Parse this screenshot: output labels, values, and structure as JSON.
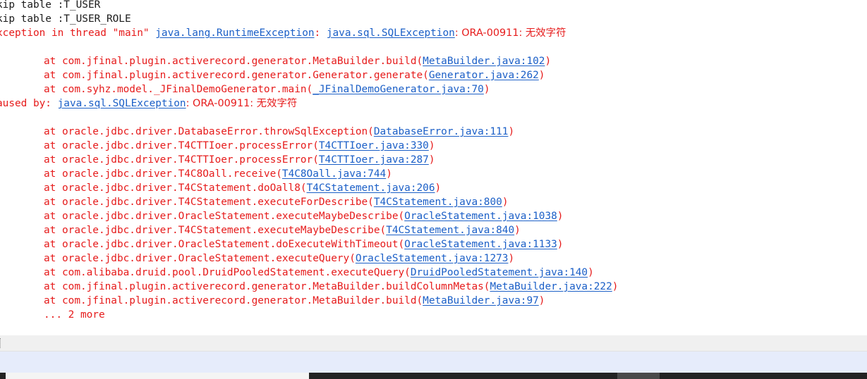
{
  "console": {
    "skip1": "kip table :T_USER",
    "skip2": "kip table :T_USER_ROLE",
    "exception": {
      "prefix": "xception in thread \"main\" ",
      "link1": "java.lang.RuntimeException",
      "sep": ": ",
      "link2": "java.sql.SQLException",
      "msg": ": ORA-00911: 无效字符"
    },
    "trace1": [
      {
        "at": "at com.jfinal.plugin.activerecord.generator.MetaBuilder.build(",
        "link": "MetaBuilder.java:102",
        "end": ")"
      },
      {
        "at": "at com.jfinal.plugin.activerecord.generator.Generator.generate(",
        "link": "Generator.java:262",
        "end": ")"
      },
      {
        "at": "at com.syhz.model._JFinalDemoGenerator.main(",
        "link": "_JFinalDemoGenerator.java:70",
        "end": ")"
      }
    ],
    "caused": {
      "prefix": "aused by: ",
      "link": "java.sql.SQLException",
      "msg": ": ORA-00911: 无效字符"
    },
    "trace2": [
      {
        "at": "at oracle.jdbc.driver.DatabaseError.throwSqlException(",
        "link": "DatabaseError.java:111",
        "end": ")"
      },
      {
        "at": "at oracle.jdbc.driver.T4CTTIoer.processError(",
        "link": "T4CTTIoer.java:330",
        "end": ")"
      },
      {
        "at": "at oracle.jdbc.driver.T4CTTIoer.processError(",
        "link": "T4CTTIoer.java:287",
        "end": ")"
      },
      {
        "at": "at oracle.jdbc.driver.T4C8Oall.receive(",
        "link": "T4C8Oall.java:744",
        "end": ")"
      },
      {
        "at": "at oracle.jdbc.driver.T4CStatement.doOall8(",
        "link": "T4CStatement.java:206",
        "end": ")"
      },
      {
        "at": "at oracle.jdbc.driver.T4CStatement.executeForDescribe(",
        "link": "T4CStatement.java:800",
        "end": ")"
      },
      {
        "at": "at oracle.jdbc.driver.OracleStatement.executeMaybeDescribe(",
        "link": "OracleStatement.java:1038",
        "end": ")"
      },
      {
        "at": "at oracle.jdbc.driver.T4CStatement.executeMaybeDescribe(",
        "link": "T4CStatement.java:840",
        "end": ")"
      },
      {
        "at": "at oracle.jdbc.driver.OracleStatement.doExecuteWithTimeout(",
        "link": "OracleStatement.java:1133",
        "end": ")"
      },
      {
        "at": "at oracle.jdbc.driver.OracleStatement.executeQuery(",
        "link": "OracleStatement.java:1273",
        "end": ")"
      },
      {
        "at": "at com.alibaba.druid.pool.DruidPooledStatement.executeQuery(",
        "link": "DruidPooledStatement.java:140",
        "end": ")"
      },
      {
        "at": "at com.jfinal.plugin.activerecord.generator.MetaBuilder.buildColumnMetas(",
        "link": "MetaBuilder.java:222",
        "end": ")"
      },
      {
        "at": "at com.jfinal.plugin.activerecord.generator.MetaBuilder.build(",
        "link": "MetaBuilder.java:97",
        "end": ")"
      }
    ],
    "more": "... 2 more"
  }
}
